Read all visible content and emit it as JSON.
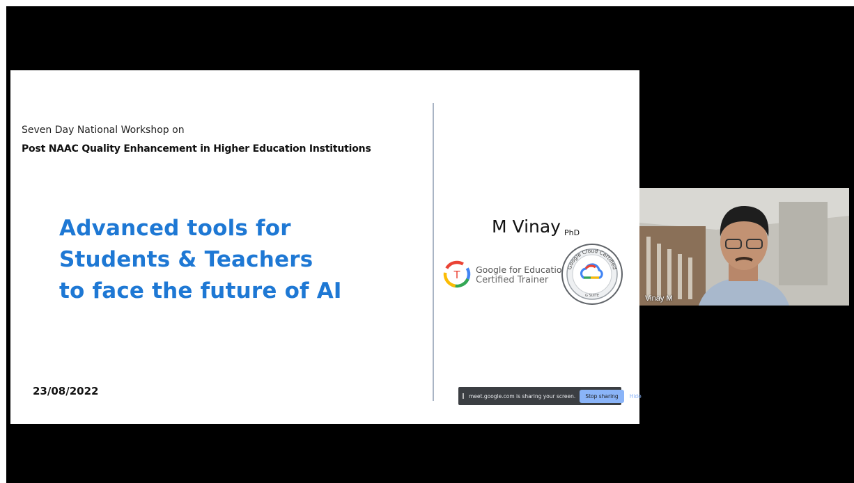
{
  "slide": {
    "subtitle": "Seven Day National Workshop on",
    "workshop_title": "Post NAAC Quality Enhancement in Higher Education Institutions",
    "headline_lines": [
      "Advanced tools for",
      "Students & Teachers",
      "to face the future of AI"
    ],
    "date": "23/08/2022",
    "presenter_name": "M Vinay",
    "presenter_degree": "PhD",
    "gfe_line1": "Google for Education",
    "gfe_line2": "Certified Trainer",
    "gfe_logo_letter": "T",
    "badge_arc_text": "Google Cloud Certified",
    "badge_bottom_text": "G SUITE",
    "headline_color": "#1e78d4"
  },
  "share_bar": {
    "message": "meet.google.com is sharing your screen.",
    "stop_label": "Stop sharing",
    "hide_label": "Hide"
  },
  "participant": {
    "name": "Vinay M"
  }
}
